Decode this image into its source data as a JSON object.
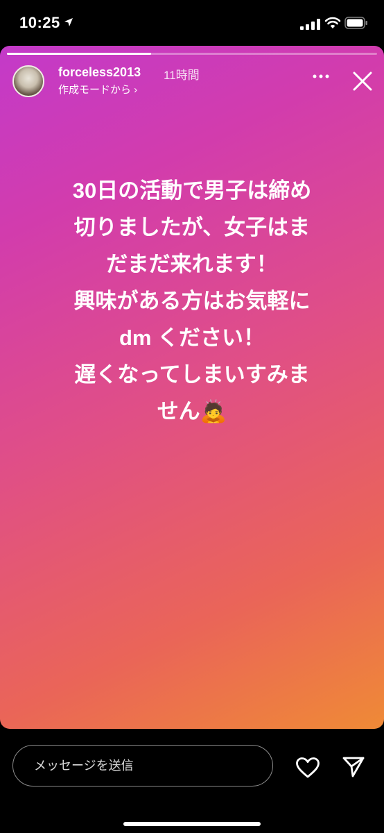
{
  "status_bar": {
    "time": "10:25",
    "icons": [
      "location-arrow-icon",
      "cellular-signal-icon",
      "wifi-icon",
      "battery-icon"
    ]
  },
  "story": {
    "progress": 0.39,
    "username": "forceless2013",
    "time_ago": "11時間",
    "subtitle": "作成モードから ›",
    "text": "30日の活動で男子は締め\n切りましたが、女子はま\nだまだ来れます！\n興味がある方はお気軽に\ndm ください！\n遅くなってしまいすみま\nせん🙇",
    "gradient_colors": [
      "#c33ac9",
      "#e04f86",
      "#ef8a36"
    ]
  },
  "bottom": {
    "message_placeholder": "メッセージを送信",
    "icons": [
      "heart-icon",
      "send-icon"
    ]
  }
}
